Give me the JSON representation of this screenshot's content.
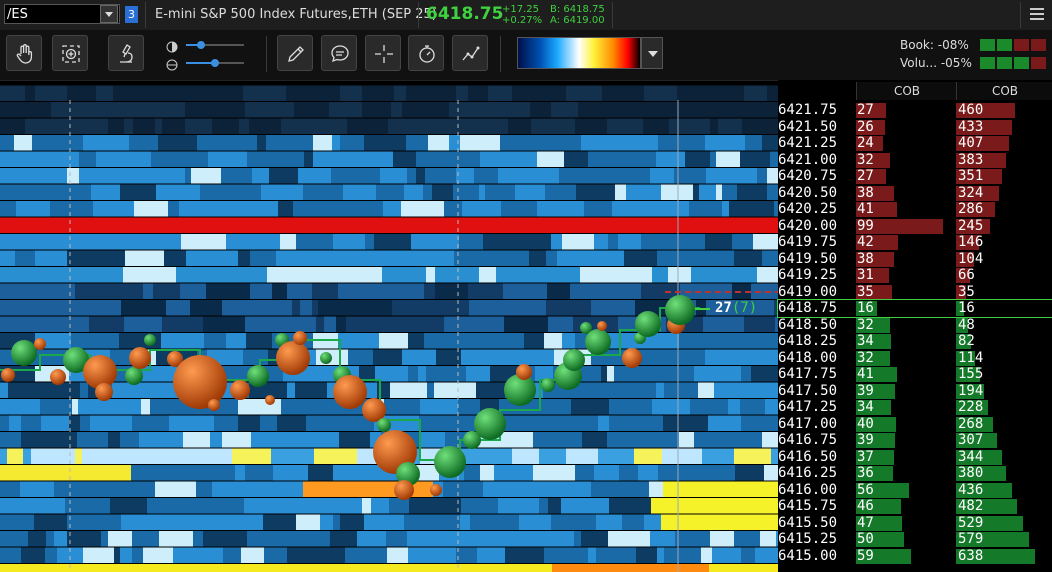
{
  "header": {
    "symbol": "/ES",
    "badge": "3",
    "description": "E-mini S&P 500 Index Futures,ETH (SEP 25)",
    "last": "6418.75",
    "change": "+17.25",
    "change_pct": "+0.27%",
    "bid": "B: 6418.75",
    "ask": "A: 6419.00"
  },
  "toolbar": {
    "book_label": "Book:",
    "book_value": "-08%",
    "volume_label": "Volu...",
    "volume_value": "-05%",
    "icons": [
      "hand-icon",
      "crosshair-zoom-icon",
      "microscope-icon",
      "pencil-icon",
      "chat-icon",
      "crosshair-icon",
      "stopwatch-icon",
      "indicator-icon"
    ]
  },
  "ladder": {
    "col1_header": "COB",
    "col2_header": "COB",
    "current_price": "6418.75",
    "current_size": "27",
    "current_delta": "(7)",
    "rows": [
      {
        "price": "6421.75",
        "c1": "27",
        "c2": "460",
        "side": "ask"
      },
      {
        "price": "6421.50",
        "c1": "26",
        "c2": "433",
        "side": "ask"
      },
      {
        "price": "6421.25",
        "c1": "24",
        "c2": "407",
        "side": "ask"
      },
      {
        "price": "6421.00",
        "c1": "32",
        "c2": "383",
        "side": "ask"
      },
      {
        "price": "6420.75",
        "c1": "27",
        "c2": "351",
        "side": "ask"
      },
      {
        "price": "6420.50",
        "c1": "38",
        "c2": "324",
        "side": "ask"
      },
      {
        "price": "6420.25",
        "c1": "41",
        "c2": "286",
        "side": "ask"
      },
      {
        "price": "6420.00",
        "c1": "99",
        "c2": "245",
        "side": "ask"
      },
      {
        "price": "6419.75",
        "c1": "42",
        "c2": "146",
        "side": "ask"
      },
      {
        "price": "6419.50",
        "c1": "38",
        "c2": "104",
        "side": "ask"
      },
      {
        "price": "6419.25",
        "c1": "31",
        "c2": "66",
        "side": "ask"
      },
      {
        "price": "6419.00",
        "c1": "35",
        "c2": "35",
        "side": "ask"
      },
      {
        "price": "6418.75",
        "c1": "16",
        "c2": "16",
        "side": "bid"
      },
      {
        "price": "6418.50",
        "c1": "32",
        "c2": "48",
        "side": "bid"
      },
      {
        "price": "6418.25",
        "c1": "34",
        "c2": "82",
        "side": "bid"
      },
      {
        "price": "6418.00",
        "c1": "32",
        "c2": "114",
        "side": "bid"
      },
      {
        "price": "6417.75",
        "c1": "41",
        "c2": "155",
        "side": "bid"
      },
      {
        "price": "6417.50",
        "c1": "39",
        "c2": "194",
        "side": "bid"
      },
      {
        "price": "6417.25",
        "c1": "34",
        "c2": "228",
        "side": "bid"
      },
      {
        "price": "6417.00",
        "c1": "40",
        "c2": "268",
        "side": "bid"
      },
      {
        "price": "6416.75",
        "c1": "39",
        "c2": "307",
        "side": "bid"
      },
      {
        "price": "6416.50",
        "c1": "37",
        "c2": "344",
        "side": "bid"
      },
      {
        "price": "6416.25",
        "c1": "36",
        "c2": "380",
        "side": "bid"
      },
      {
        "price": "6416.00",
        "c1": "56",
        "c2": "436",
        "side": "bid"
      },
      {
        "price": "6415.75",
        "c1": "46",
        "c2": "482",
        "side": "bid"
      },
      {
        "price": "6415.50",
        "c1": "47",
        "c2": "529",
        "side": "bid"
      },
      {
        "price": "6415.25",
        "c1": "50",
        "c2": "579",
        "side": "bid"
      },
      {
        "price": "6415.00",
        "c1": "59",
        "c2": "638",
        "side": "bid"
      }
    ]
  },
  "colors": {
    "ask": "#7a1a1a",
    "bid": "#147a2a",
    "up": "#3fd13f"
  }
}
